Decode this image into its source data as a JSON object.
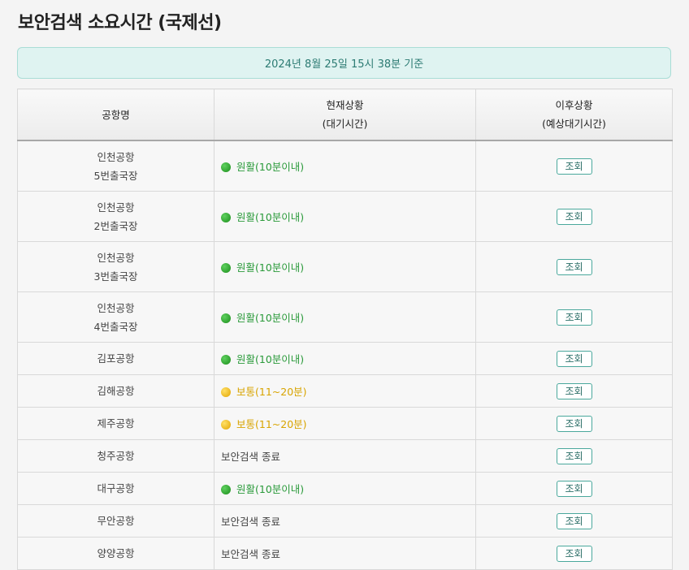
{
  "page_title": "보안검색 소요시간 (국제선)",
  "notice": "2024년 8월 25일 15시 38분 기준",
  "table": {
    "headers": {
      "airport": "공항명",
      "current_line1": "현재상황",
      "current_line2": "(대기시간)",
      "future_line1": "이후상황",
      "future_line2": "(예상대기시간)"
    },
    "rows": [
      {
        "name1": "인천공항",
        "name2": "5번출국장",
        "status": "원활(10분이내)",
        "level": "green",
        "action": "조회"
      },
      {
        "name1": "인천공항",
        "name2": "2번출국장",
        "status": "원활(10분이내)",
        "level": "green",
        "action": "조회"
      },
      {
        "name1": "인천공항",
        "name2": "3번출국장",
        "status": "원활(10분이내)",
        "level": "green",
        "action": "조회"
      },
      {
        "name1": "인천공항",
        "name2": "4번출국장",
        "status": "원활(10분이내)",
        "level": "green",
        "action": "조회"
      },
      {
        "name1": "김포공항",
        "status": "원활(10분이내)",
        "level": "green",
        "action": "조회"
      },
      {
        "name1": "김해공항",
        "status": "보통(11~20분)",
        "level": "yellow",
        "action": "조회"
      },
      {
        "name1": "제주공항",
        "status": "보통(11~20분)",
        "level": "yellow",
        "action": "조회"
      },
      {
        "name1": "청주공항",
        "status": "보안검색 종료",
        "level": "closed",
        "action": "조회"
      },
      {
        "name1": "대구공항",
        "status": "원활(10분이내)",
        "level": "green",
        "action": "조회"
      },
      {
        "name1": "무안공항",
        "status": "보안검색 종료",
        "level": "closed",
        "action": "조회"
      },
      {
        "name1": "양양공항",
        "status": "보안검색 종료",
        "level": "closed",
        "action": "조회"
      }
    ]
  },
  "colors": {
    "smooth": "#2a9a3a",
    "normal": "#d8a400",
    "accent": "#2c7b73"
  }
}
